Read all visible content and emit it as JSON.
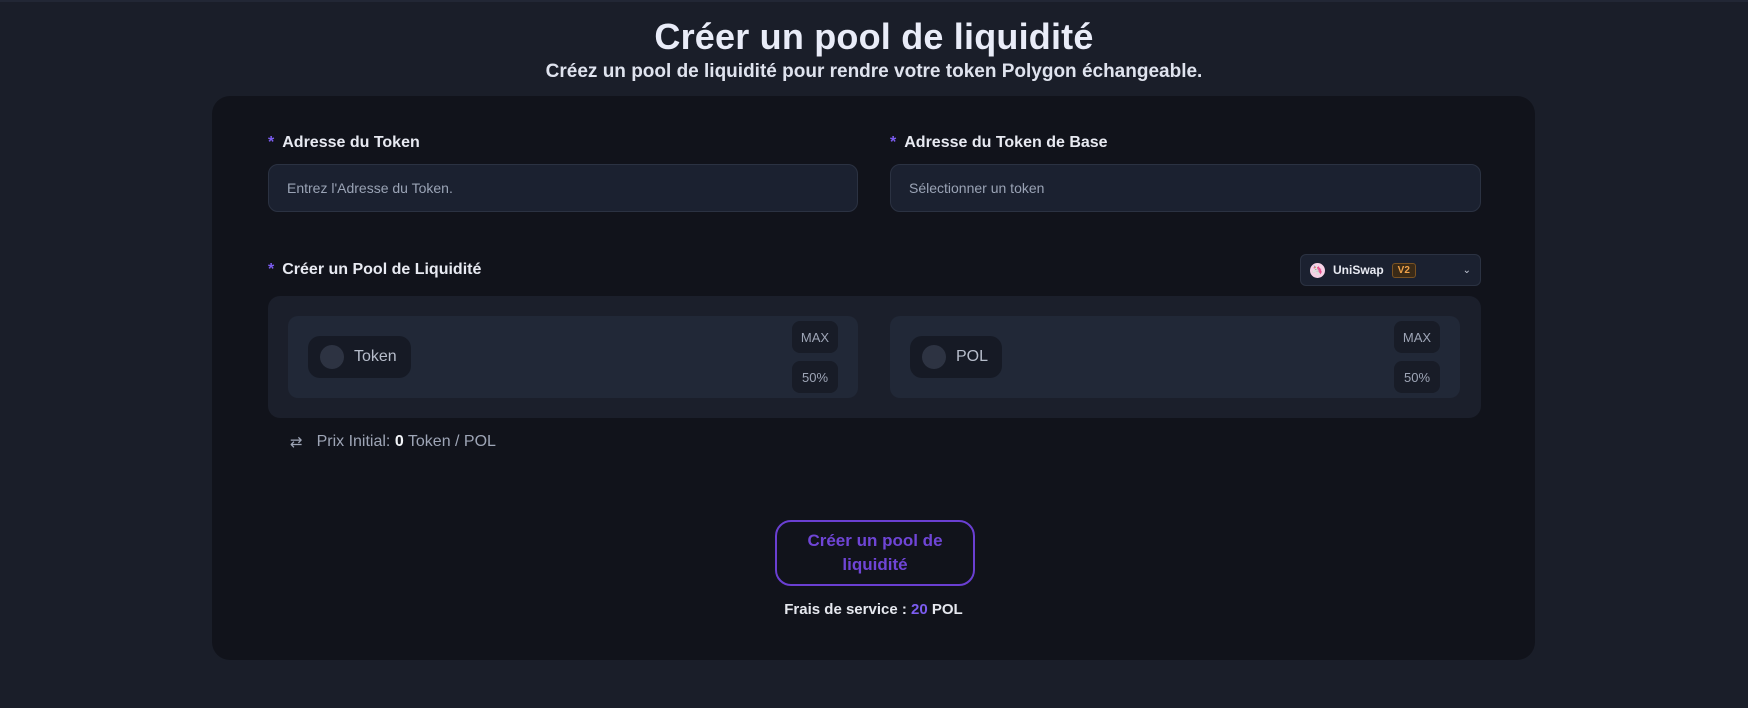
{
  "page": {
    "title": "Créer un pool de liquidité",
    "subtitle": "Créez un pool de liquidité pour rendre votre token Polygon échangeable."
  },
  "form": {
    "required_marker": "*",
    "token_address": {
      "label": "Adresse du Token",
      "placeholder": "Entrez l'Adresse du Token.",
      "value": ""
    },
    "base_token": {
      "label": "Adresse du Token de Base",
      "placeholder": "Sélectionner un token"
    },
    "pool": {
      "label": "Créer un Pool de Liquidité",
      "dex": {
        "name": "UniSwap",
        "version": "V2",
        "logo_icon": "uniswap-logo-icon",
        "chevron_icon": "chevron-down-icon"
      },
      "left": {
        "token": "Token",
        "max_label": "MAX",
        "half_label": "50%"
      },
      "right": {
        "token": "POL",
        "max_label": "MAX",
        "half_label": "50%"
      }
    },
    "initial_price": {
      "icon": "swap-arrows-icon",
      "label": "Prix Initial:",
      "value": "0",
      "pair": "Token / POL"
    },
    "submit_label": "Créer un pool de liquidité",
    "fee": {
      "label": "Frais de service :",
      "amount": "20",
      "unit": "POL"
    }
  },
  "colors": {
    "background": "#1a1e29",
    "card": "#11131b",
    "accent": "#7c5cf0",
    "button_border": "#6a3fd2"
  }
}
